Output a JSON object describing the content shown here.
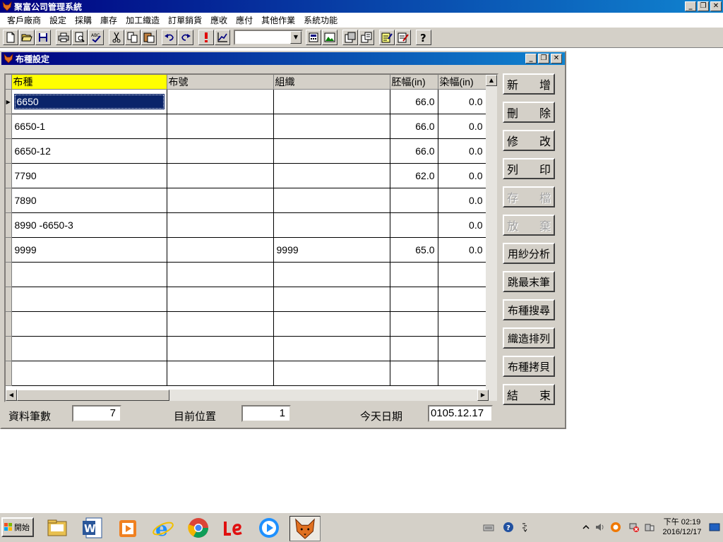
{
  "app": {
    "title": "聚富公司管理系統",
    "buttons": {
      "minimize": "_",
      "restore": "❐",
      "close": "✕"
    }
  },
  "menu": [
    "客戶廠商",
    "設定",
    "採購",
    "庫存",
    "加工織造",
    "訂單銷貨",
    "應收",
    "應付",
    "其他作業",
    "系統功能"
  ],
  "toolbar": {
    "combo_value": ""
  },
  "form": {
    "title": "布種設定",
    "columns": [
      "布種",
      "布號",
      "組織",
      "胚幅(in)",
      "染幅(in)"
    ],
    "rows": [
      [
        "6650",
        "",
        "",
        "66.0",
        "0.0"
      ],
      [
        "6650-1",
        "",
        "",
        "66.0",
        "0.0"
      ],
      [
        "6650-12",
        "",
        "",
        "66.0",
        "0.0"
      ],
      [
        "7790",
        "",
        "",
        "62.0",
        "0.0"
      ],
      [
        "7890",
        "",
        "",
        "",
        "0.0"
      ],
      [
        "8990 -6650-3",
        "",
        "",
        "",
        "0.0"
      ],
      [
        "9999",
        "",
        "9999",
        "65.0",
        "0.0"
      ],
      [
        "",
        "",
        "",
        "",
        ""
      ],
      [
        "",
        "",
        "",
        "",
        ""
      ],
      [
        "",
        "",
        "",
        "",
        ""
      ],
      [
        "",
        "",
        "",
        "",
        ""
      ],
      [
        "",
        "",
        "",
        "",
        ""
      ]
    ],
    "buttons": [
      {
        "label": "新增",
        "enabled": true,
        "spread": true
      },
      {
        "label": "刪除",
        "enabled": true,
        "spread": true
      },
      {
        "label": "修改",
        "enabled": true,
        "spread": true
      },
      {
        "label": "列印",
        "enabled": true,
        "spread": true
      },
      {
        "label": "存檔",
        "enabled": false,
        "spread": true
      },
      {
        "label": "放棄",
        "enabled": false,
        "spread": true
      },
      {
        "label": "用紗分析",
        "enabled": true,
        "spread": false
      },
      {
        "label": "跳最末筆",
        "enabled": true,
        "spread": false
      },
      {
        "label": "布種搜尋",
        "enabled": true,
        "spread": false
      },
      {
        "label": "織造排列",
        "enabled": true,
        "spread": false
      },
      {
        "label": "布種拷貝",
        "enabled": true,
        "spread": false
      },
      {
        "label": "結束",
        "enabled": true,
        "spread": true
      }
    ],
    "status": {
      "record_count_label": "資料筆數",
      "record_count": "7",
      "position_label": "目前位置",
      "position": "1",
      "today_label": "今天日期",
      "today": "0105.12.17"
    }
  },
  "taskbar": {
    "start_label": "開始",
    "clock_time": "下午 02:19",
    "clock_date": "2016/12/17"
  }
}
